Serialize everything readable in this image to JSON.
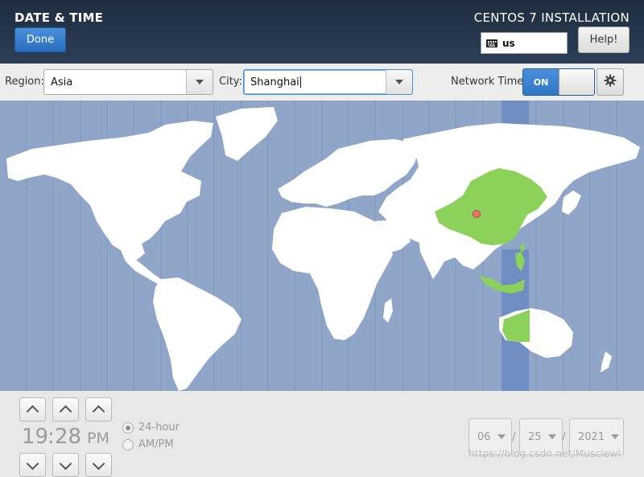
{
  "header": {
    "title": "DATE & TIME",
    "product": "CENTOS 7 INSTALLATION",
    "done_label": "Done",
    "keyboard_layout": "us",
    "help_label": "Help!"
  },
  "location": {
    "region_label": "Region:",
    "region_value": "Asia",
    "city_label": "City:",
    "city_value": "Shanghai"
  },
  "network_time": {
    "label": "Network Time",
    "state": "ON"
  },
  "map": {
    "selected_zone_color": "#8cd15a",
    "ocean_color": "#8fa6c8",
    "land_color": "#ffffff",
    "highlight_band_color": "#6f8fc2",
    "marker": "Shanghai"
  },
  "clock": {
    "hours": "19",
    "separator": ":",
    "minutes": "28",
    "meridiem": "PM",
    "format_24h": "24-hour",
    "format_ampm": "AM/PM",
    "selected_format": "24-hour"
  },
  "date": {
    "month": "06",
    "day": "25",
    "year": "2021",
    "separator": "/"
  },
  "watermark": "https://blog.csdn.net/Musclewl"
}
